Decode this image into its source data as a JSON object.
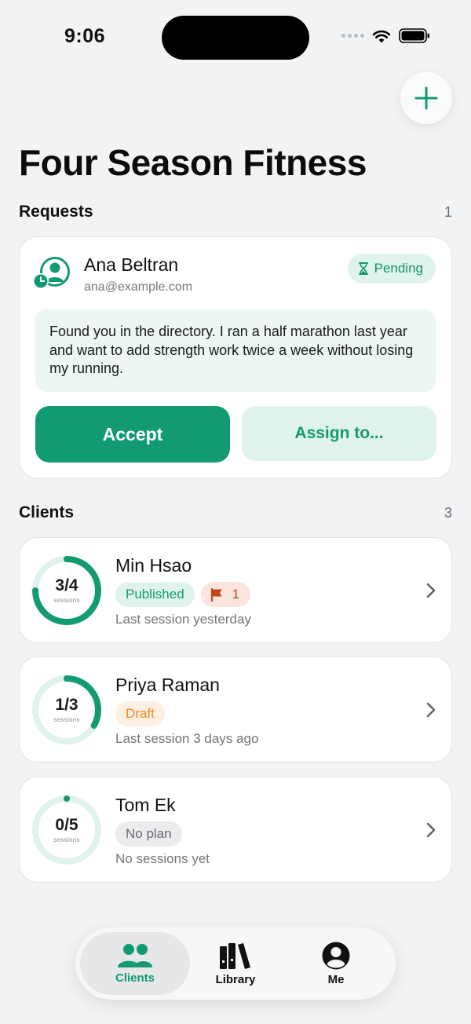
{
  "status_bar": {
    "time": "9:06"
  },
  "header": {
    "title": "Four Season Fitness"
  },
  "requests": {
    "title": "Requests",
    "count": "1",
    "items": [
      {
        "name": "Ana Beltran",
        "email": "ana@example.com",
        "status": "Pending",
        "message": "Found you in the directory. I ran a half marathon last year and want to add strength work twice a week without losing my running.",
        "accept_label": "Accept",
        "assign_label": "Assign to..."
      }
    ]
  },
  "clients": {
    "title": "Clients",
    "count": "3",
    "items": [
      {
        "name": "Min Hsao",
        "sessions_text": "3/4",
        "sessions_done": 3,
        "sessions_total": 4,
        "unit": "sessions",
        "badge": "Published",
        "flag_count": "1",
        "last": "Last session yesterday"
      },
      {
        "name": "Priya Raman",
        "sessions_text": "1/3",
        "sessions_done": 1,
        "sessions_total": 3,
        "unit": "sessions",
        "badge": "Draft",
        "last": "Last session 3 days ago"
      },
      {
        "name": "Tom Ek",
        "sessions_text": "0/5",
        "sessions_done": 0,
        "sessions_total": 5,
        "unit": "sessions",
        "badge": "No plan",
        "last": "No sessions yet"
      }
    ]
  },
  "tabs": [
    {
      "label": "Clients",
      "icon": "people-icon",
      "active": true
    },
    {
      "label": "Library",
      "icon": "books-icon",
      "active": false
    },
    {
      "label": "Me",
      "icon": "person-circle-icon",
      "active": false
    }
  ],
  "colors": {
    "accent": "#129b72",
    "accent_light": "#dff3ec",
    "draft": "#ec8a2e",
    "flag": "#c0451b",
    "background": "#f2f3f5"
  }
}
